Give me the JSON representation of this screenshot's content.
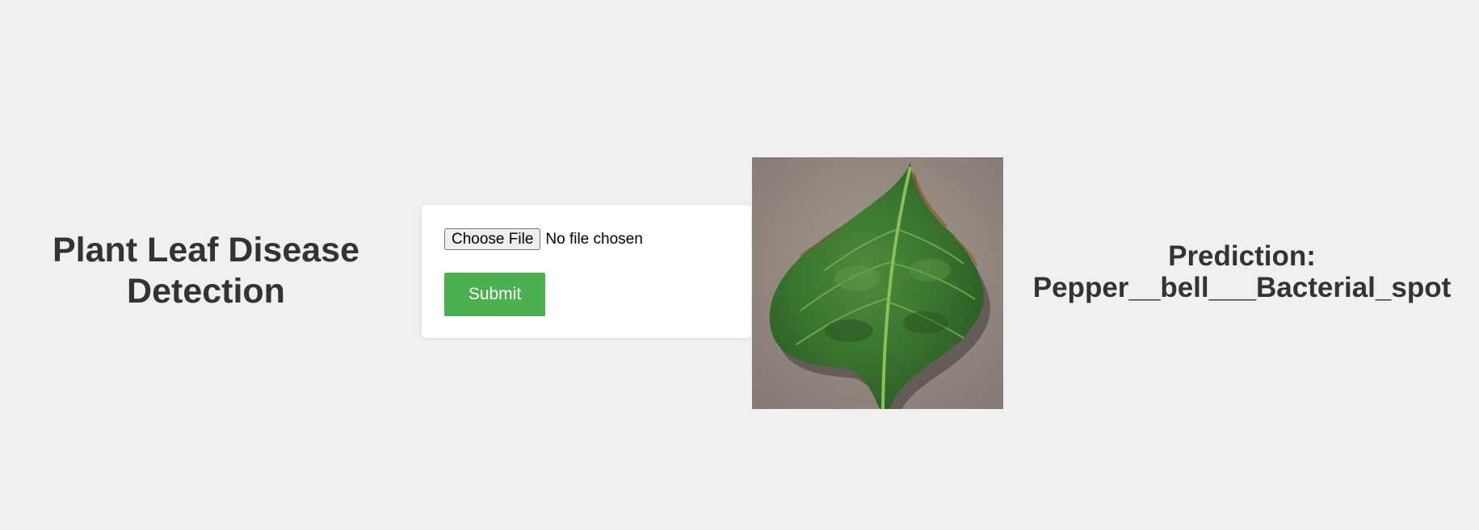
{
  "header": {
    "title": "Plant Leaf Disease Detection"
  },
  "upload_form": {
    "choose_file_label": "Choose File",
    "file_status": "No file chosen",
    "submit_label": "Submit"
  },
  "result": {
    "prediction_label": "Prediction:",
    "prediction_value": "Pepper__bell___Bacterial_spot"
  },
  "colors": {
    "background": "#f0f0f0",
    "text": "#333333",
    "submit_button": "#4caf50",
    "card": "#ffffff"
  },
  "icons": {
    "uploaded_image": "green pepper leaf photo"
  }
}
